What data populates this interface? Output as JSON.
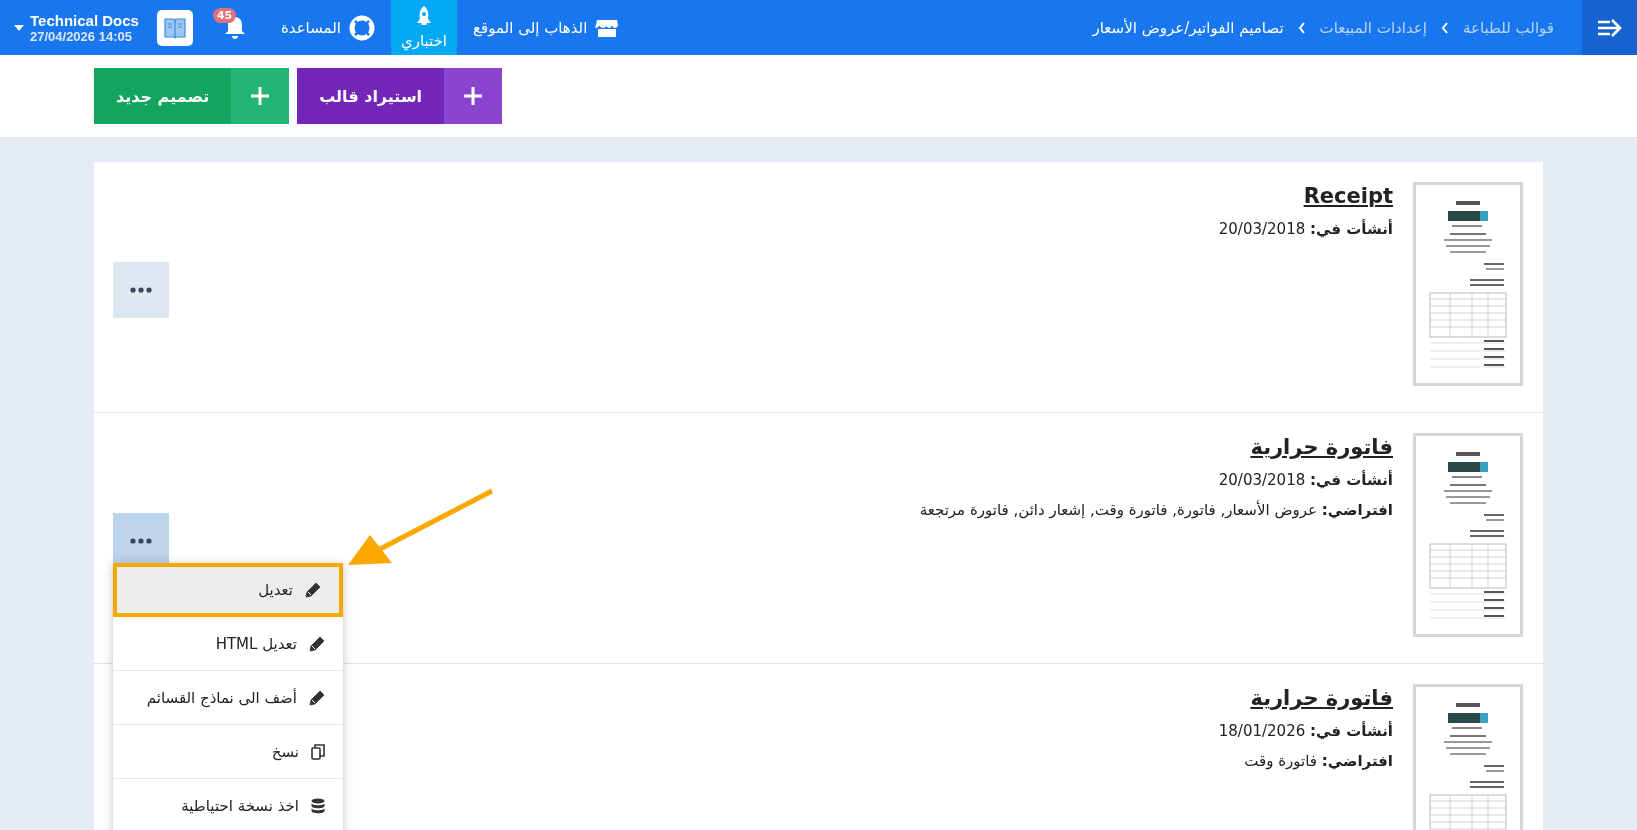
{
  "topbar": {
    "breadcrumbs": [
      {
        "label": "قوالب للطباعة",
        "current": false
      },
      {
        "label": "إعدادات المبيعات",
        "current": false
      },
      {
        "label": "تصاميم الفواتير/عروض الأسعار",
        "current": true
      }
    ],
    "site_link": "الذهاب إلى الموقع",
    "test_tab": {
      "label": "اختباري",
      "selected": true
    },
    "help": "المساعدة",
    "notifications": "45",
    "user": {
      "name": "Technical Docs",
      "datetime": "14:05 27/04/2026"
    }
  },
  "actions": [
    {
      "label": "استيراد قالب",
      "kind": "import"
    },
    {
      "label": "تصميم جديد",
      "kind": "new"
    }
  ],
  "templates": [
    {
      "title": "Receipt",
      "created_label": "أنشأت في:",
      "created_date": "20/03/2018",
      "menu_open": false
    },
    {
      "title": "فاتورة حرارية",
      "created_label": "أنشأت في:",
      "created_date": "20/03/2018",
      "default_label": "افتراضي:",
      "default_value": "عروض الأسعار, فاتورة, فاتورة وقت, إشعار دائن, فاتورة مرتجعة",
      "menu_open": true
    },
    {
      "title": "فاتورة حرارية",
      "created_label": "أنشأت في:",
      "created_date": "18/01/2026",
      "default_label": "افتراضي:",
      "default_value": "فاتورة وقت"
    }
  ],
  "menu": [
    {
      "label": "تعديل",
      "kind": "edit",
      "highlighted": true
    },
    {
      "label": "تعديل HTML",
      "kind": "edit",
      "highlighted": false
    },
    {
      "label": "أضف الى نماذج القسائم",
      "kind": "edit",
      "highlighted": false
    },
    {
      "label": "نسخ",
      "kind": "copy",
      "highlighted": false
    },
    {
      "label": "اخذ نسخة احتياطية",
      "kind": "backup",
      "highlighted": false
    }
  ]
}
